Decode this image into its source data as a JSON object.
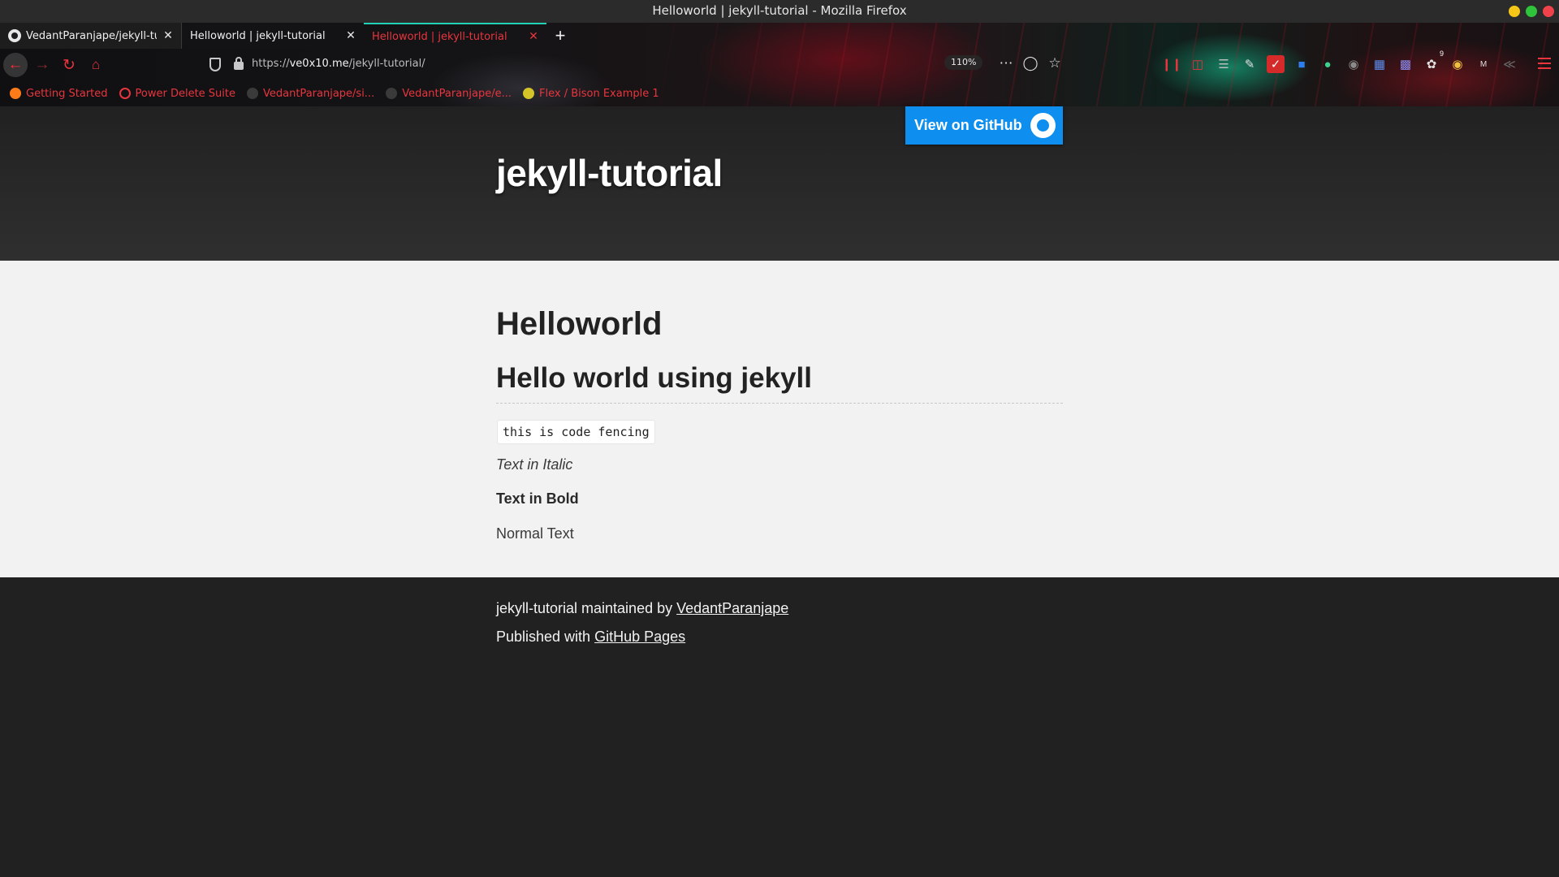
{
  "window": {
    "title": "Helloworld | jekyll-tutorial - Mozilla Firefox",
    "controls": {
      "minimize_color": "#f5c518",
      "maximize_color": "#2fc53b",
      "close_color": "#f0424a"
    }
  },
  "tabs": [
    {
      "label": "VedantParanjape/jekyll-tutorial",
      "icon": "github-icon",
      "active": false
    },
    {
      "label": "Helloworld | jekyll-tutorial",
      "active": false
    },
    {
      "label": "Helloworld | jekyll-tutorial",
      "active": true
    }
  ],
  "new_tab_glyph": "+",
  "close_glyph": "✕",
  "navbar": {
    "url_prefix": "https://",
    "url_host": "ve0x10.me",
    "url_path": "/jekyll-tutorial/",
    "zoom": "110%",
    "extension_badge": "9"
  },
  "bookmarks": [
    {
      "label": "Getting Started",
      "icon": "firefox-icon",
      "color": "#ff7b1a"
    },
    {
      "label": "Power Delete Suite",
      "icon": "globe-icon",
      "color": "#e8353e"
    },
    {
      "label": "VedantParanjape/si...",
      "icon": "github-icon",
      "color": "#3a3a3a"
    },
    {
      "label": "VedantParanjape/e...",
      "icon": "github-icon",
      "color": "#3a3a3a"
    },
    {
      "label": "Flex / Bison Example 1",
      "icon": "star-icon",
      "color": "#d4c42a"
    }
  ],
  "page": {
    "github_button": "View on GitHub",
    "project_title": "jekyll-tutorial",
    "heading1": "Helloworld",
    "heading2": "Hello world using jekyll",
    "code": "this is code fencing",
    "italic_text": "Text in Italic",
    "bold_text": "Text in Bold",
    "normal_text": "Normal Text",
    "footer": {
      "maintained_prefix": "jekyll-tutorial maintained by ",
      "maintainer_link": "VedantParanjape",
      "published_prefix": "Published with ",
      "published_link": "GitHub Pages"
    }
  },
  "colors": {
    "accent_red": "#e8353e",
    "active_tab_line": "#21d2b9",
    "github_button": "#0e8fef",
    "content_bg": "#f2f2f2",
    "dark_bg": "#212121"
  }
}
